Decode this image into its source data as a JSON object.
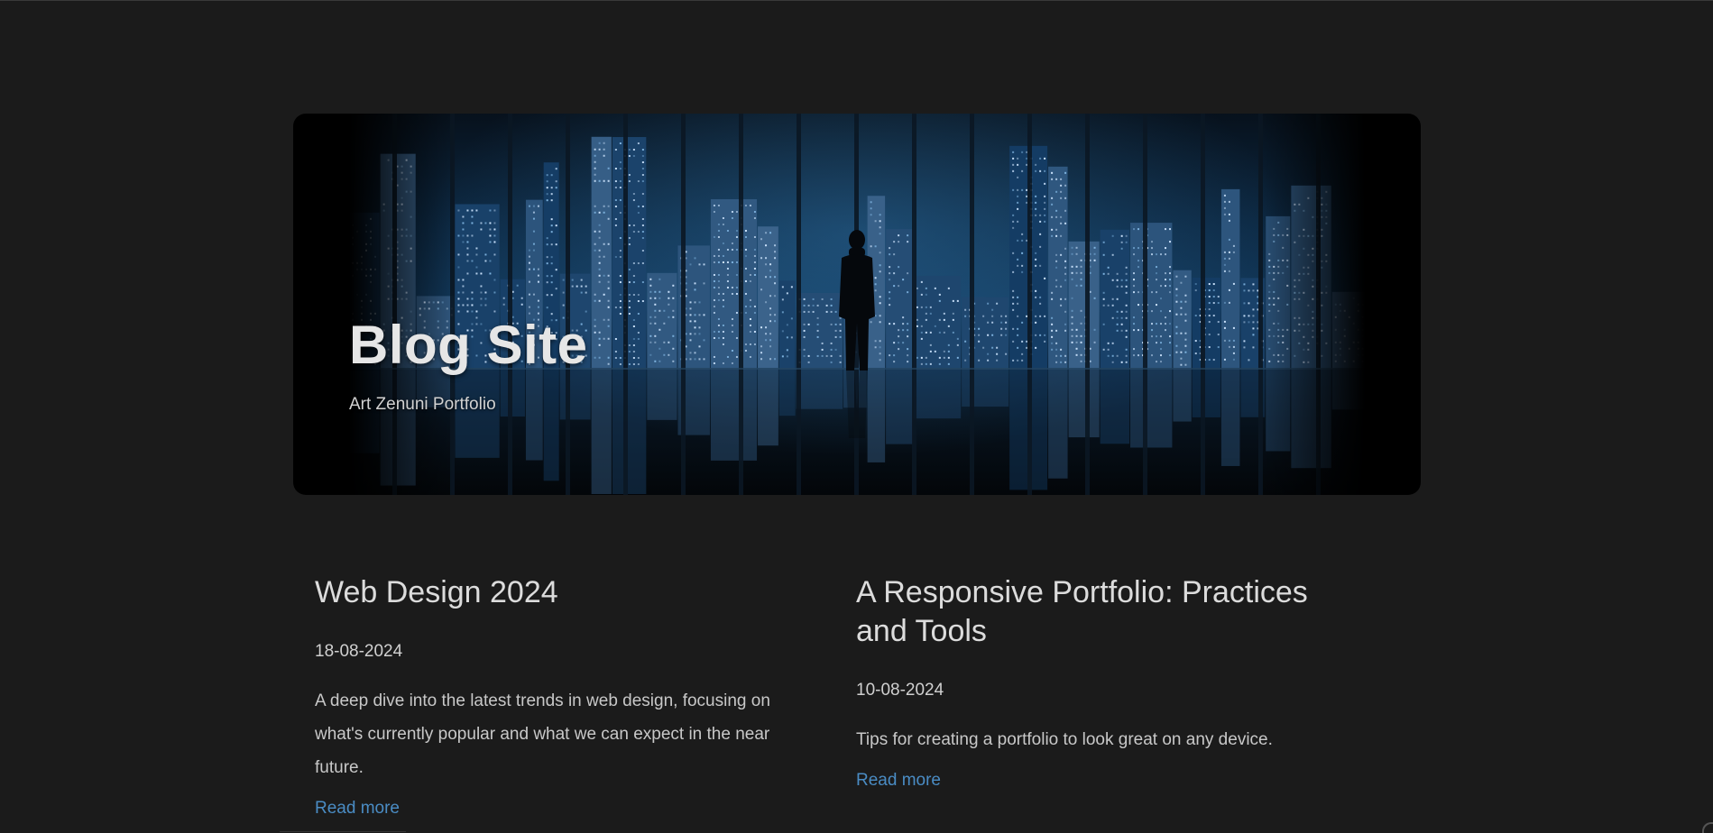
{
  "hero": {
    "title": "Blog Site",
    "subtitle": "Art Zenuni Portfolio"
  },
  "posts": [
    {
      "title": "Web Design 2024",
      "date": "18-08-2024",
      "excerpt": "A deep dive into the latest trends in web design, focusing on what's currently popular and what we can expect in the near future.",
      "link_label": "Read more"
    },
    {
      "title": "A Responsive Portfolio: Practices and Tools",
      "date": "10-08-2024",
      "excerpt": "Tips for creating a portfolio to look great on any device.",
      "link_label": "Read more"
    }
  ],
  "colors": {
    "background": "#1b1b1b",
    "link": "#4a8cc4",
    "text": "#dcdcdc"
  }
}
